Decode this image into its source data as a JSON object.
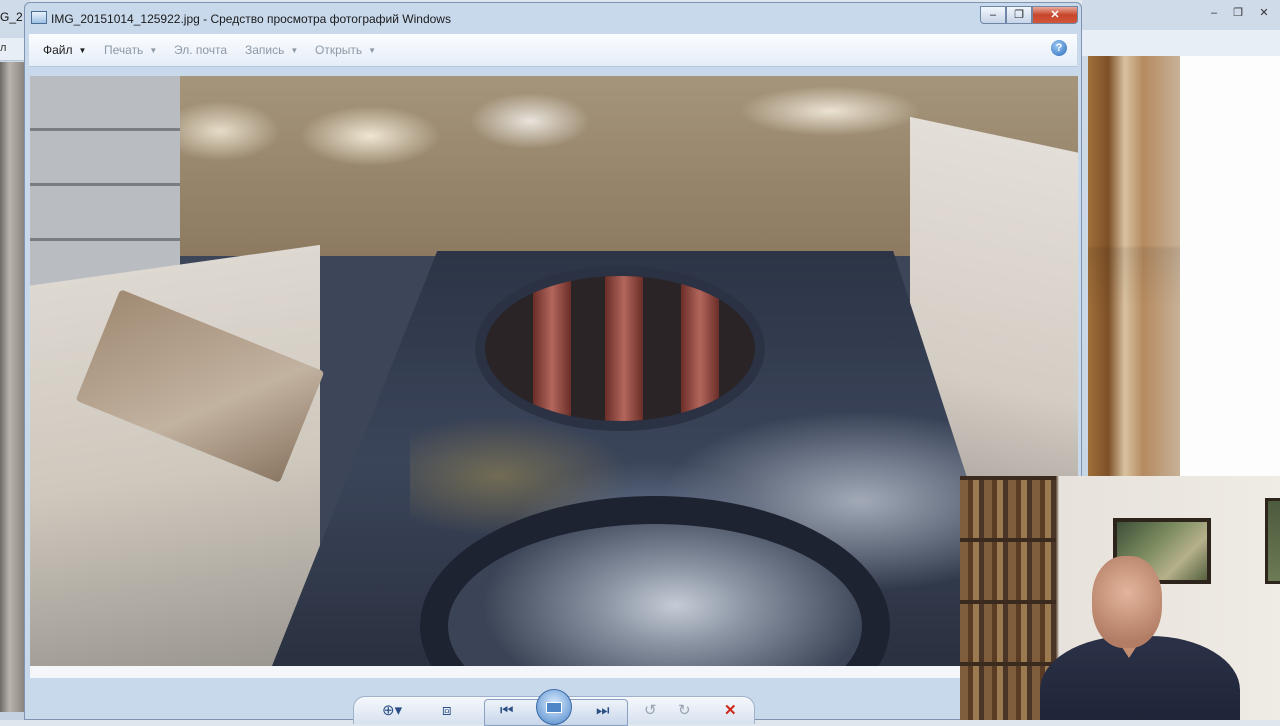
{
  "background": {
    "left_window": {
      "title_fragment": "G_2",
      "menu_fragment": "л"
    },
    "right_window": {
      "controls": [
        "–",
        "❐",
        "✕"
      ]
    }
  },
  "window": {
    "title": "IMG_20151014_125922.jpg - Средство просмотра фотографий Windows",
    "controls": {
      "minimize": "–",
      "maximize": "❐",
      "close": "✕"
    }
  },
  "menu": {
    "items": [
      {
        "label": "Файл",
        "arrow": "▼"
      },
      {
        "label": "Печать",
        "arrow": "▼"
      },
      {
        "label": "Эл. почта",
        "arrow": ""
      },
      {
        "label": "Запись",
        "arrow": "▼"
      },
      {
        "label": "Открыть",
        "arrow": "▼"
      }
    ],
    "help": "?"
  },
  "controls": {
    "zoom": "⊕▾",
    "fit": "⧈",
    "previous": "⏮",
    "next": "⏭",
    "rotate_left": "↺",
    "rotate_right": "↻",
    "delete": "✕"
  },
  "colors": {
    "accent": "#2b4f84",
    "close": "#c7462b",
    "delete": "#d0261a"
  }
}
